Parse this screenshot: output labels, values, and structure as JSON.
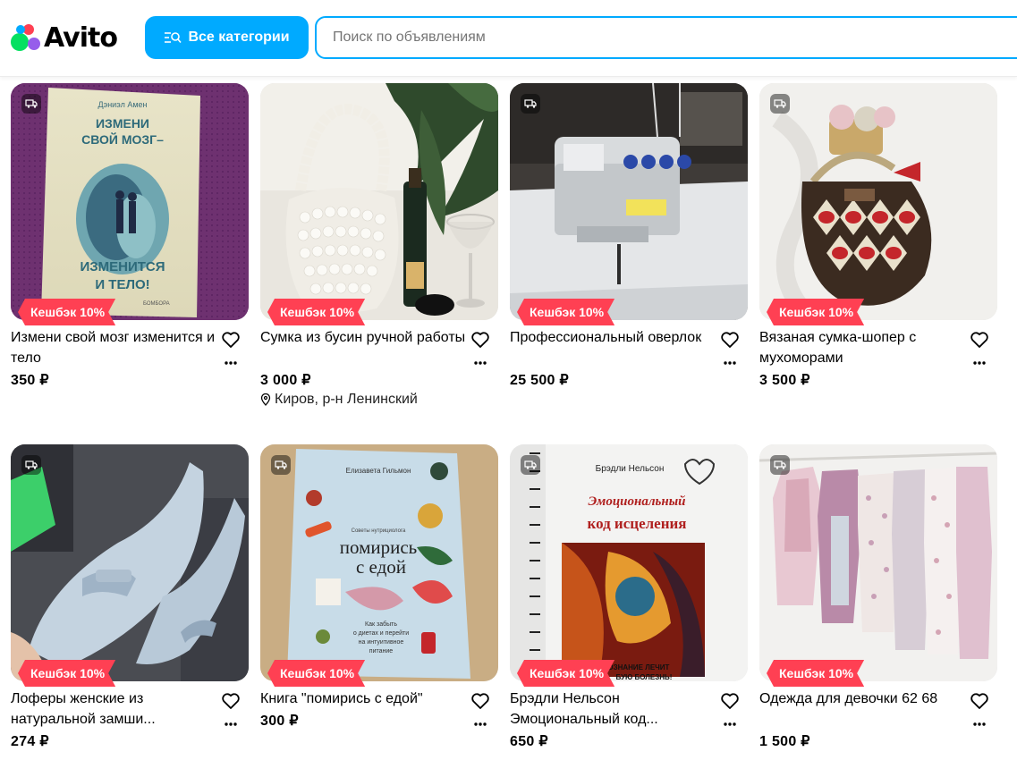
{
  "header": {
    "logo_text": "Avito",
    "categories_label": "Все категории",
    "search_placeholder": "Поиск по объявлениям"
  },
  "cashback_label": "Кешбэк 10%",
  "listings": [
    {
      "title": "Измени свой мозг изменится и тело",
      "price": "350 ₽",
      "location": "",
      "cover_texts": [
        "Дэниэл Амен",
        "ИЗМЕНИ СВОЙ МОЗГ–",
        "ИЗМЕНИТСЯ И ТЕЛО!",
        "БОМБОРА"
      ]
    },
    {
      "title": "Сумка из бусин ручной работы",
      "price": "3 000 ₽",
      "location": "Киров, р-н Ленинский",
      "cover_texts": []
    },
    {
      "title": "Профессиональный оверлок",
      "price": "25 500 ₽",
      "location": "",
      "cover_texts": []
    },
    {
      "title": "Вязаная сумка-шопер с мухоморами",
      "price": "3 500 ₽",
      "location": "",
      "cover_texts": []
    },
    {
      "title": "Лоферы женские из натуральной замши...",
      "price": "274 ₽",
      "location": "",
      "cover_texts": []
    },
    {
      "title": "Книга \"помирись с едой\"",
      "price": "300 ₽",
      "location": "",
      "cover_texts": [
        "Елизавета Гильмон",
        "Советы нутрициолога",
        "помирись с едой",
        "Как забыть о диетах и перейти на интуитивное питание"
      ]
    },
    {
      "title": "Брэдли Нельсон Эмоциональный код...",
      "price": "650 ₽",
      "location": "",
      "cover_texts": [
        "Брэдли Нельсон",
        "Эмоциональный",
        "код исцеления",
        "ОСОЗНАНИЕ ЛЕЧИТ",
        "БУЮ БОЛЕЗНЬ!"
      ]
    },
    {
      "title": "Одежда для девочки 62 68",
      "price": "1 500 ₽",
      "location": "",
      "cover_texts": []
    }
  ],
  "colors": {
    "accent": "#00aaff",
    "cashback": "#ff4053"
  },
  "icons": [
    "search-icon",
    "delivery-icon",
    "heart-icon",
    "more-icon",
    "location-pin-icon"
  ]
}
